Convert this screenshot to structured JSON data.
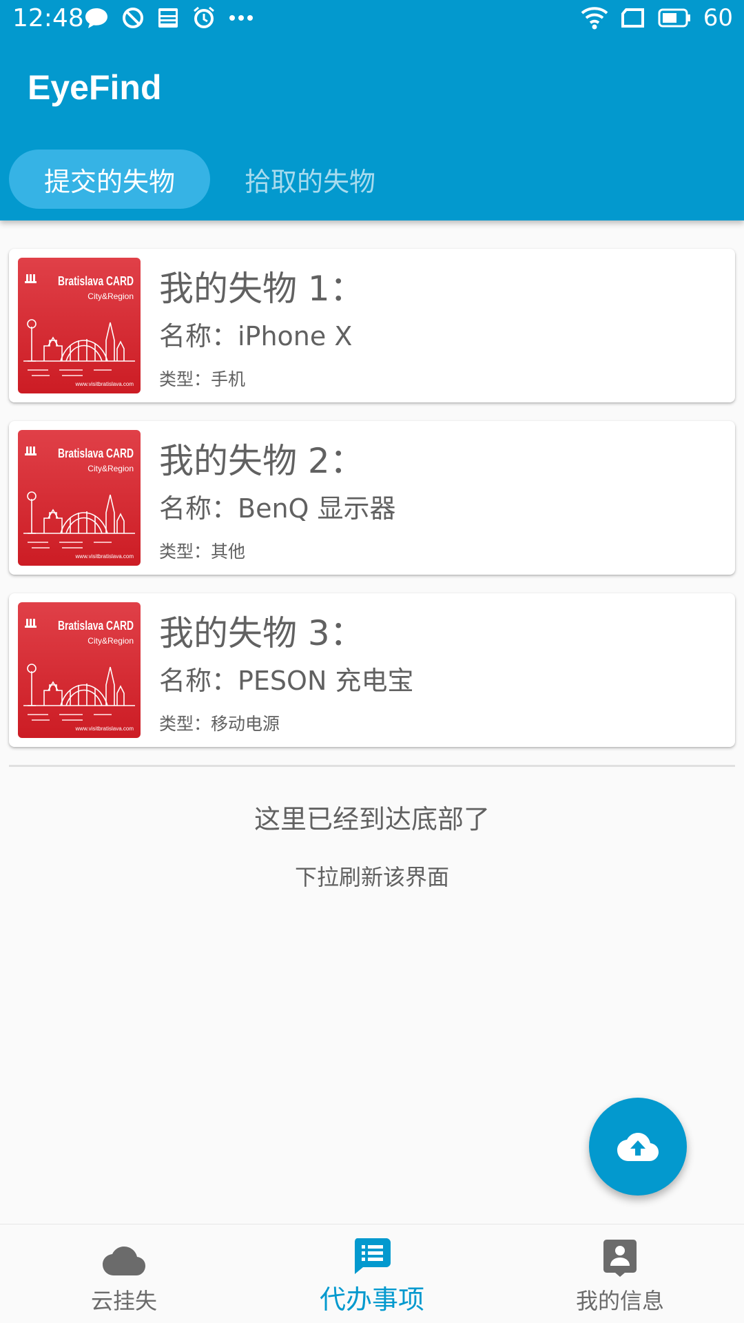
{
  "status_bar": {
    "time": "12:48",
    "battery": "60",
    "icons_left": [
      "chat-bubble-icon",
      "blocked-icon",
      "news-icon",
      "alarm-icon",
      "more-dots-icon"
    ],
    "icons_right": [
      "wifi-icon",
      "sim-icon",
      "battery-icon"
    ]
  },
  "app": {
    "title": "EyeFind"
  },
  "tabs": [
    {
      "label": "提交的失物",
      "active": true
    },
    {
      "label": "拾取的失物",
      "active": false
    }
  ],
  "items": [
    {
      "title": "我的失物 1：",
      "name": "名称：iPhone X",
      "type": "类型：手机",
      "image_text": "Bratislava CARD",
      "image_sub": "City&Region",
      "image_url_text": "www.visitbratislava.com"
    },
    {
      "title": "我的失物 2：",
      "name": "名称：BenQ 显示器",
      "type": "类型：其他",
      "image_text": "Bratislava CARD",
      "image_sub": "City&Region",
      "image_url_text": "www.visitbratislava.com"
    },
    {
      "title": "我的失物 3：",
      "name": "名称：PESON 充电宝",
      "type": "类型：移动电源",
      "image_text": "Bratislava CARD",
      "image_sub": "City&Region",
      "image_url_text": "www.visitbratislava.com"
    }
  ],
  "list_end": {
    "message": "这里已经到达底部了",
    "hint": "下拉刷新该界面"
  },
  "fab": {
    "icon": "cloud-upload-icon"
  },
  "bottom_nav": [
    {
      "label": "云挂失",
      "icon": "cloud-icon",
      "active": false
    },
    {
      "label": "代办事项",
      "icon": "message-list-icon",
      "active": true
    },
    {
      "label": "我的信息",
      "icon": "account-box-icon",
      "active": false
    }
  ],
  "colors": {
    "primary": "#0399ce",
    "tab_active": "#36b3e5",
    "card_image": "#d8232a",
    "text": "#616161"
  }
}
